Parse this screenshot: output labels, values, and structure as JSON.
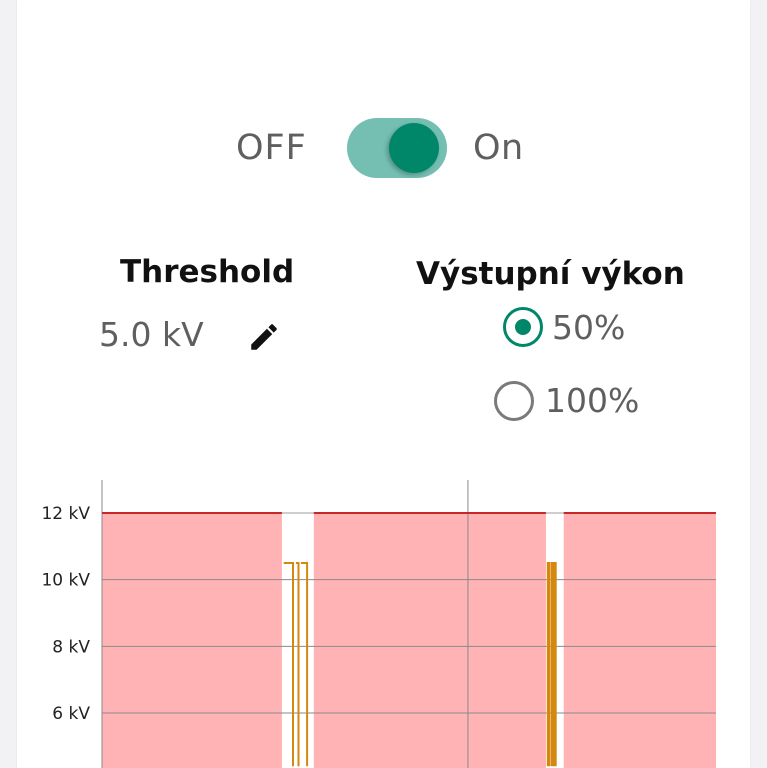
{
  "power_toggle": {
    "off_label": "OFF",
    "on_label": "On",
    "state": "on"
  },
  "threshold": {
    "title": "Threshold",
    "value": "5.0 kV",
    "edit_icon": "pencil-icon"
  },
  "output_power": {
    "title": "Výstupní výkon",
    "options": [
      {
        "label": "50%",
        "selected": true
      },
      {
        "label": "100%",
        "selected": false
      }
    ]
  },
  "colors": {
    "accent": "#00876a",
    "accent_light": "#74bfb2",
    "area_fill": "#ffb3b5",
    "limit_line": "#c62828",
    "signal_line": "#d4880f"
  },
  "chart_data": {
    "type": "area",
    "y_unit": "kV",
    "y_tick_labels": [
      "12 kV",
      "10 kV",
      "8 kV",
      "6 kV"
    ],
    "y_ticks": [
      12,
      10,
      8,
      6
    ],
    "ylim": [
      4.4,
      13.0
    ],
    "x_start": 0,
    "x_end": 100,
    "x_gridlines": [
      0,
      59.6
    ],
    "limit_line_value": 12,
    "area_segments": [
      {
        "x_start": 0,
        "x_end": 29.3,
        "value": 12
      },
      {
        "x_start": 34.5,
        "x_end": 72.3,
        "value": 12
      },
      {
        "x_start": 75.2,
        "x_end": 100,
        "value": 12
      }
    ],
    "signal_series": [
      {
        "x": [
          29.6,
          31.1,
          31.1
        ],
        "y": [
          10.5,
          10.5,
          4.4
        ]
      },
      {
        "x": [
          31.6,
          32.0,
          32.0
        ],
        "y": [
          10.5,
          10.5,
          4.4
        ]
      },
      {
        "x": [
          32.4,
          33.4,
          33.4
        ],
        "y": [
          10.5,
          10.5,
          4.4
        ]
      },
      {
        "x": [
          72.6,
          72.6,
          72.8,
          72.8
        ],
        "y": [
          4.4,
          10.5,
          10.5,
          4.4
        ]
      },
      {
        "x": [
          73.2,
          73.2,
          73.4,
          73.4
        ],
        "y": [
          4.4,
          10.5,
          10.5,
          4.4
        ]
      },
      {
        "x": [
          73.7,
          73.7,
          73.9,
          73.9
        ],
        "y": [
          4.4,
          10.5,
          10.5,
          4.4
        ]
      }
    ],
    "grid": true
  }
}
